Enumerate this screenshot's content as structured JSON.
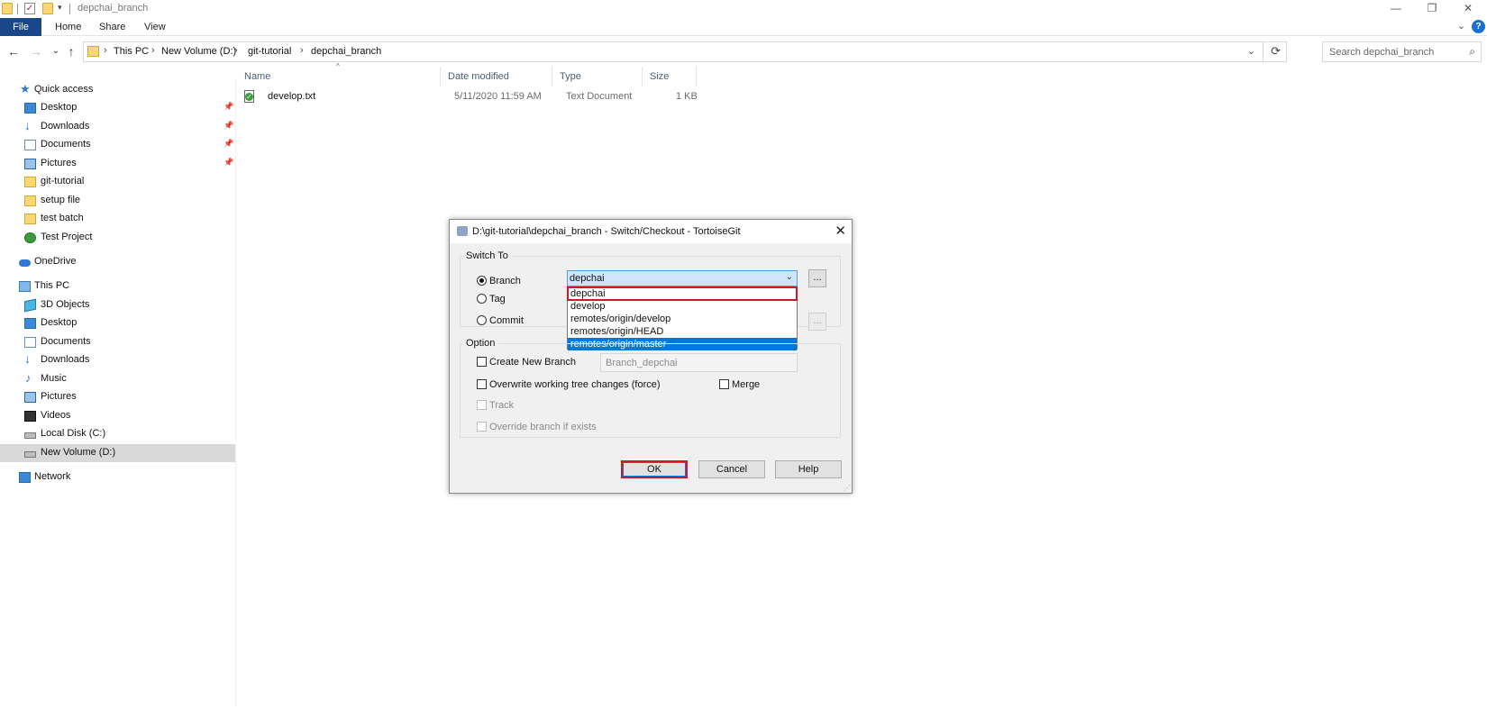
{
  "window": {
    "title": "depchai_branch",
    "controls": {
      "minimize": "—",
      "maximize": "❐",
      "close": "✕"
    }
  },
  "ribbon": {
    "tabs": [
      "File",
      "Home",
      "Share",
      "View"
    ],
    "help": "?",
    "expand": "⌄"
  },
  "nav": {
    "back": "←",
    "forward": "→",
    "recent": "⌄",
    "up": "↑",
    "breadcrumb": [
      "This PC",
      "New Volume (D:)",
      "git-tutorial",
      "depchai_branch"
    ],
    "separator": "›",
    "dropdown": "⌄",
    "refresh": "⟳",
    "search_placeholder": "Search depchai_branch",
    "search_icon": "⌕"
  },
  "sidebar": {
    "pin_glyph": "📌",
    "items": [
      {
        "label": "Quick access",
        "icon": "star-icon"
      },
      {
        "label": "Desktop",
        "icon": "desktop-icon",
        "pinned": true
      },
      {
        "label": "Downloads",
        "icon": "download-icon",
        "pinned": true
      },
      {
        "label": "Documents",
        "icon": "documents-icon",
        "pinned": true
      },
      {
        "label": "Pictures",
        "icon": "pictures-icon",
        "pinned": true
      },
      {
        "label": "git-tutorial",
        "icon": "folder-icon"
      },
      {
        "label": "setup file",
        "icon": "folder-icon"
      },
      {
        "label": "test batch",
        "icon": "folder-icon"
      },
      {
        "label": "Test Project",
        "icon": "project-icon"
      },
      {
        "label": "OneDrive",
        "icon": "cloud-icon"
      },
      {
        "label": "This PC",
        "icon": "computer-icon"
      },
      {
        "label": "3D Objects",
        "icon": "cube-icon"
      },
      {
        "label": "Desktop",
        "icon": "desktop-icon"
      },
      {
        "label": "Documents",
        "icon": "documents-icon"
      },
      {
        "label": "Downloads",
        "icon": "download-icon"
      },
      {
        "label": "Music",
        "icon": "music-icon"
      },
      {
        "label": "Pictures",
        "icon": "pictures-icon"
      },
      {
        "label": "Videos",
        "icon": "video-icon"
      },
      {
        "label": "Local Disk (C:)",
        "icon": "drive-icon"
      },
      {
        "label": "New Volume (D:)",
        "icon": "drive-icon",
        "selected": true
      },
      {
        "label": "Network",
        "icon": "network-icon"
      }
    ]
  },
  "file_list": {
    "columns": [
      "Name",
      "Date modified",
      "Type",
      "Size"
    ],
    "sort_indicator": "^",
    "rows": [
      {
        "name": "develop.txt",
        "date": "5/11/2020 11:59 AM",
        "type": "Text Document",
        "size": "1 KB"
      }
    ]
  },
  "dialog": {
    "title": "D:\\git-tutorial\\depchai_branch - Switch/Checkout - TortoiseGit",
    "close": "✕",
    "switch_to": {
      "legend": "Switch To",
      "options": [
        "Branch",
        "Tag",
        "Commit"
      ],
      "selected": "Branch",
      "branch_value": "depchai",
      "combo_arrow": "⌄",
      "ellipsis": "...",
      "dropdown_items": [
        "depchai",
        "develop",
        "remotes/origin/develop",
        "remotes/origin/HEAD",
        "remotes/origin/master"
      ],
      "highlighted_item": "remotes/origin/master",
      "boxed_item": "depchai"
    },
    "option": {
      "legend": "Option",
      "create_new_branch": "Create New Branch",
      "new_branch_name": "Branch_depchai",
      "overwrite": "Overwrite working tree changes (force)",
      "merge": "Merge",
      "track": "Track",
      "override": "Override branch if exists"
    },
    "buttons": {
      "ok": "OK",
      "cancel": "Cancel",
      "help": "Help"
    },
    "grip": "⋰"
  },
  "colors": {
    "accent": "#0078d7",
    "highlight_box": "#d0182a",
    "file_tab": "#19478a"
  }
}
